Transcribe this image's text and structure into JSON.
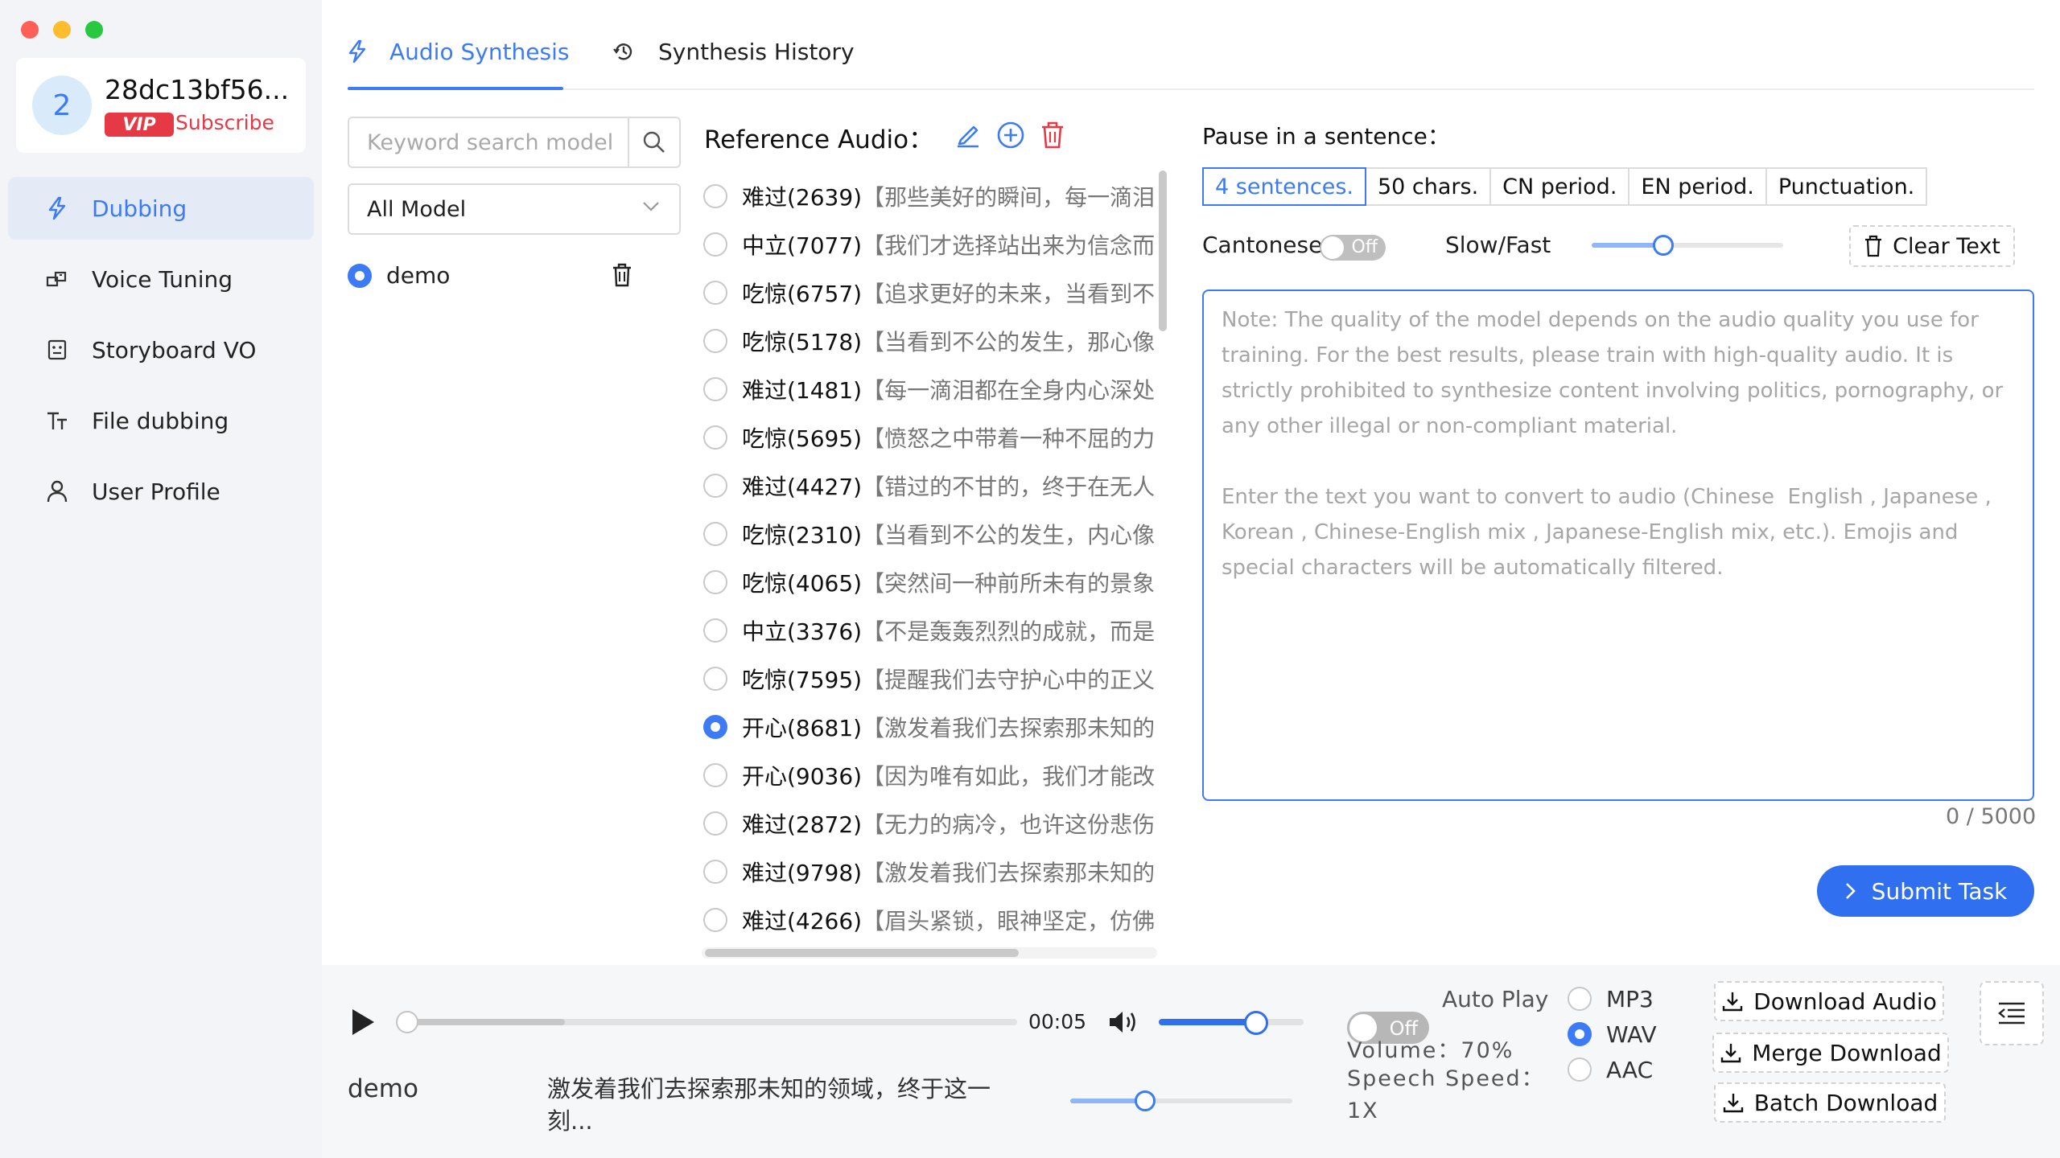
{
  "window": {
    "controls": {
      "close_color": "#ff5f57",
      "minimize_color": "#febc2e",
      "maximize_color": "#28c840"
    }
  },
  "user": {
    "avatar_letter": "2",
    "name": "28dc13bf56...",
    "badge": "VIP",
    "subscribe_label": "Subscribe"
  },
  "sidebar": {
    "items": [
      {
        "label": "Dubbing",
        "icon": "lightning-icon",
        "active": true
      },
      {
        "label": "Voice Tuning",
        "icon": "voice-tuning-icon"
      },
      {
        "label": "Storyboard VO",
        "icon": "storyboard-icon"
      },
      {
        "label": "File dubbing",
        "icon": "text-icon"
      },
      {
        "label": "User Profile",
        "icon": "user-icon"
      }
    ]
  },
  "tabs": [
    {
      "label": "Audio Synthesis",
      "icon": "lightning-icon",
      "active": true
    },
    {
      "label": "Synthesis History",
      "icon": "history-icon"
    }
  ],
  "models": {
    "search_placeholder": "Keyword search model",
    "filter_value": "All Model",
    "items": [
      {
        "name": "demo",
        "selected": true
      }
    ]
  },
  "reference": {
    "title": "Reference Audio：",
    "items": [
      {
        "emotion": "难过(2639)",
        "text": "【那些美好的瞬间，每一滴泪都"
      },
      {
        "emotion": "中立(7077)",
        "text": "【我们才选择站出来为信念而战"
      },
      {
        "emotion": "吃惊(6757)",
        "text": "【追求更好的未来，当看到不公"
      },
      {
        "emotion": "吃惊(5178)",
        "text": "【当看到不公的发生，那心像火"
      },
      {
        "emotion": "难过(1481)",
        "text": "【每一滴泪都在全身内心深处。"
      },
      {
        "emotion": "吃惊(5695)",
        "text": "【愤怒之中带着一种不屈的力量"
      },
      {
        "emotion": "难过(4427)",
        "text": "【错过的不甘的，终于在无人问"
      },
      {
        "emotion": "吃惊(2310)",
        "text": "【当看到不公的发生，内心像火"
      },
      {
        "emotion": "吃惊(4065)",
        "text": "【突然间一种前所未有的景象出"
      },
      {
        "emotion": "中立(3376)",
        "text": "【不是轰轰烈烈的成就，而是这"
      },
      {
        "emotion": "吃惊(7595)",
        "text": "【提醒我们去守护心中的正义，"
      },
      {
        "emotion": "开心(8681)",
        "text": "【激发着我们去探索那未知的领",
        "selected": true
      },
      {
        "emotion": "开心(9036)",
        "text": "【因为唯有如此，我们才能改变"
      },
      {
        "emotion": "难过(2872)",
        "text": "【无力的病冷，也许这份悲伤，"
      },
      {
        "emotion": "难过(9798)",
        "text": "【激发着我们去探索那未知的领"
      },
      {
        "emotion": "难过(4266)",
        "text": "【眉头紧锁，眼神坚定，仿佛一"
      }
    ]
  },
  "settings": {
    "pause_label": "Pause in a sentence：",
    "pause_options": [
      "4 sentences.",
      "50 chars.",
      "CN period.",
      "EN period.",
      "Punctuation."
    ],
    "pause_selected": "4 sentences.",
    "cantonese_label": "Cantonese",
    "cantonese_toggle": "Off",
    "slow_fast_label": "Slow/Fast",
    "slow_fast_level": 0.38,
    "clear_label": "Clear Text",
    "text_placeholder": "Note: The quality of the model depends on the audio quality you use for training. For the best results, please train with high-quality audio. It is strictly prohibited to synthesize content involving politics, pornography, or any other illegal or non-compliant material.\n\nEnter the text you want to convert to audio (Chinese  English , Japanese , Korean , Chinese-English mix , Japanese-English mix, etc.). Emojis and special characters will be automatically filtered.",
    "counter": "0 / 5000",
    "submit_label": "Submit Task"
  },
  "player": {
    "current_time": "00:05",
    "progress": 0.0,
    "buffered": 0.27,
    "volume_level": 0.7,
    "track_name": "demo",
    "track_text": "激发着我们去探索那未知的领域，终于这一刻...",
    "rate_level": 0.35,
    "auto_play_toggle": "Off",
    "auto_play_label": "Auto Play",
    "volume_label": "Volume：70%",
    "speech_speed_label": "Speech Speed：1X",
    "formats": [
      {
        "label": "MP3"
      },
      {
        "label": "WAV",
        "selected": true
      },
      {
        "label": "AAC"
      }
    ],
    "download_audio": "Download Audio",
    "merge_download": "Merge Download",
    "batch_download": "Batch Download"
  },
  "colors": {
    "accent": "#3c7bf5",
    "vip": "#e63946",
    "sidebar_bg": "#f3f4f7"
  }
}
